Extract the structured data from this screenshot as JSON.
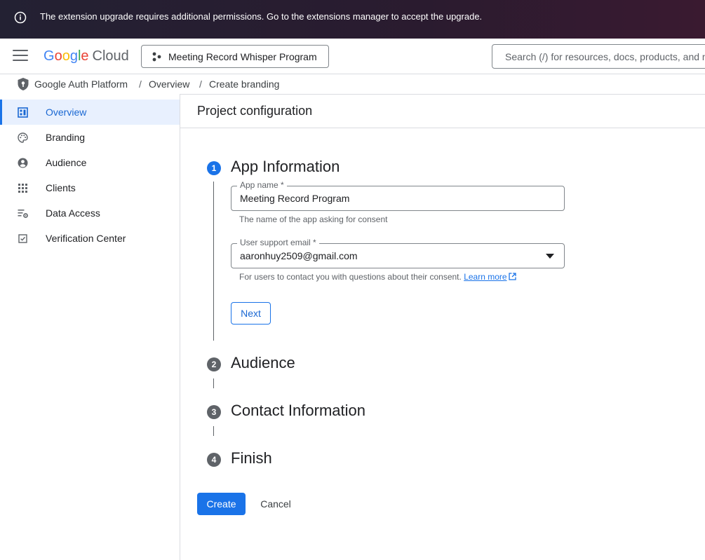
{
  "banner": {
    "message": "The extension upgrade requires additional permissions. Go to the extensions manager to accept the upgrade.",
    "icon": "info-icon"
  },
  "header": {
    "logo": {
      "letters": [
        "G",
        "o",
        "o",
        "g",
        "l",
        "e"
      ],
      "product": "Cloud"
    },
    "project_name": "Meeting Record Whisper Program",
    "search_placeholder": "Search (/) for resources, docs, products, and more"
  },
  "breadcrumb": {
    "items": [
      "Google Auth Platform",
      "Overview",
      "Create branding"
    ],
    "separator": "/"
  },
  "sidebar": {
    "items": [
      {
        "label": "Overview",
        "icon": "dashboard-icon",
        "active": true
      },
      {
        "label": "Branding",
        "icon": "palette-icon",
        "active": false
      },
      {
        "label": "Audience",
        "icon": "account-circle-icon",
        "active": false
      },
      {
        "label": "Clients",
        "icon": "apps-grid-icon",
        "active": false
      },
      {
        "label": "Data Access",
        "icon": "list-settings-icon",
        "active": false
      },
      {
        "label": "Verification Center",
        "icon": "checkbox-icon",
        "active": false
      }
    ]
  },
  "main": {
    "title": "Project configuration",
    "steps": [
      {
        "number": "1",
        "title": "App Information",
        "active": true
      },
      {
        "number": "2",
        "title": "Audience",
        "active": false
      },
      {
        "number": "3",
        "title": "Contact Information",
        "active": false
      },
      {
        "number": "4",
        "title": "Finish",
        "active": false
      }
    ],
    "app_name": {
      "label": "App name *",
      "value": "Meeting Record Program",
      "hint": "The name of the app asking for consent"
    },
    "support_email": {
      "label": "User support email *",
      "value": "aaronhuy2509@gmail.com",
      "hint": "For users to contact you with questions about their consent.",
      "learn_more": "Learn more"
    },
    "next_label": "Next",
    "create_label": "Create",
    "cancel_label": "Cancel"
  },
  "colors": {
    "accent": "#1a73e8",
    "active_nav_bg": "#e8f0fe",
    "banner_bg": "#2a1b2f"
  }
}
